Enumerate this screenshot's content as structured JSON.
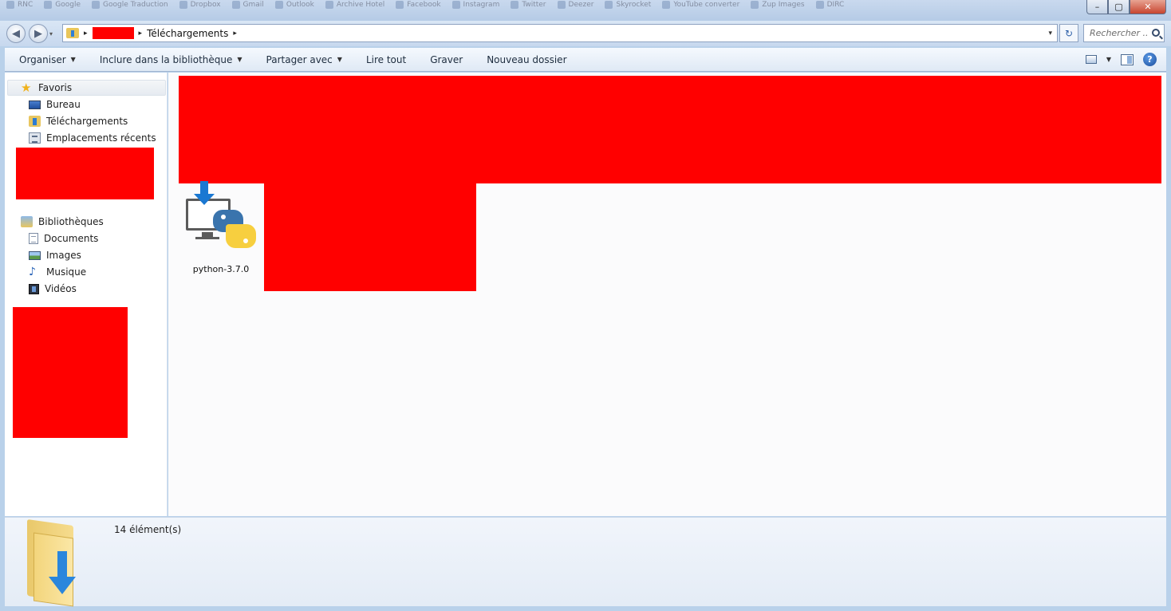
{
  "titlebar": {
    "bookmarks": [
      "RNC",
      "Google",
      "Google Traduction",
      "Dropbox",
      "Gmail",
      "Outlook",
      "Archive Hotel",
      "Facebook",
      "Instagram",
      "Twitter",
      "Deezer",
      "Skyrocket",
      "YouTube converter",
      "Zup Images",
      "DIRC"
    ],
    "minimize_label": "–",
    "maximize_label": "▢",
    "close_label": "✕"
  },
  "address": {
    "back_label": "◀",
    "forward_label": "▶",
    "dropdown_label": "▾",
    "crumbs": [
      "Téléchargements"
    ],
    "separator": "▸",
    "refresh_label": "↻",
    "search_placeholder": "Rechercher ..."
  },
  "toolbar": {
    "items": [
      {
        "label": "Organiser",
        "dropdown": true
      },
      {
        "label": "Inclure dans la bibliothèque",
        "dropdown": true
      },
      {
        "label": "Partager avec",
        "dropdown": true
      },
      {
        "label": "Lire tout",
        "dropdown": false
      },
      {
        "label": "Graver",
        "dropdown": false
      },
      {
        "label": "Nouveau dossier",
        "dropdown": false
      }
    ],
    "caret": "▼",
    "help_label": "?"
  },
  "sidebar": {
    "favorites_header": "Favoris",
    "favorites": [
      {
        "label": "Bureau",
        "icon": "desktop-icon"
      },
      {
        "label": "Téléchargements",
        "icon": "downloads-folder-icon"
      },
      {
        "label": "Emplacements récents",
        "icon": "recent-places-icon"
      }
    ],
    "libraries_header": "Bibliothèques",
    "libraries": [
      {
        "label": "Documents",
        "icon": "documents-icon"
      },
      {
        "label": "Images",
        "icon": "images-icon"
      },
      {
        "label": "Musique",
        "icon": "music-icon"
      },
      {
        "label": "Vidéos",
        "icon": "videos-icon"
      }
    ]
  },
  "content": {
    "files": [
      {
        "name": "python-3.7.0",
        "icon": "python-installer-icon"
      }
    ]
  },
  "details": {
    "count_text": "14 élément(s)"
  },
  "colors": {
    "redaction": "#ff0000",
    "accent": "#1a78d2",
    "folder": "#f3d57c"
  }
}
